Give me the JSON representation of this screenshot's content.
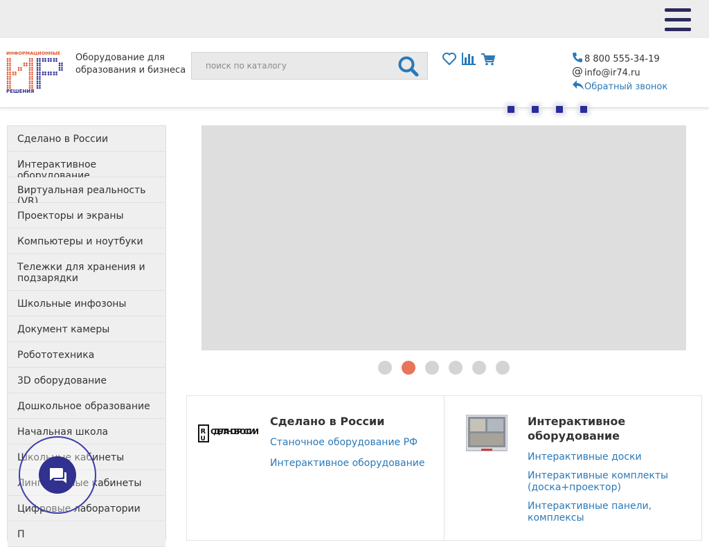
{
  "header": {
    "menu_icon": "hamburger-icon",
    "logo": {
      "top_text": "ИНФОРМАЦИОННЫЕ",
      "bottom_text": "РЕШЕНИЯ",
      "colors": [
        "#e0542d",
        "#2c2a8e"
      ]
    },
    "tagline": "Оборудование для образования и бизнеса",
    "search": {
      "placeholder": "поиск по каталогу",
      "icon": "search-icon"
    },
    "icons": [
      "heart-icon",
      "chart-icon",
      "cart-icon"
    ],
    "contacts": {
      "phone": "8 800 555-34-19",
      "email": "info@ir74.ru",
      "callback": "Обратный звонок"
    }
  },
  "sidebar": {
    "items": [
      "Сделано в России",
      "Интерактивное оборудование",
      "Виртуальная реальность (VR)",
      "Проекторы и экраны",
      "Компьютеры и ноутбуки",
      "Тележки для хранения и подзарядки",
      "Школьные инфозоны",
      "Документ камеры",
      "Робототехника",
      "3D оборудование",
      "Дошкольное образование",
      "Начальная школа",
      "Школьные кабинеты",
      "Лингафонные кабинеты",
      "Цифровые лаборатории",
      "П"
    ]
  },
  "slider": {
    "slide_count": 6,
    "active_index": 1
  },
  "cards": [
    {
      "title": "Сделано в России",
      "image_text": "СДЕЛАНО В РОССИИ",
      "links": [
        "Станочное оборудование РФ",
        "Интерактивное оборудование"
      ]
    },
    {
      "title": "Интерактивное оборудование",
      "image": "interactive-board-image",
      "links": [
        "Интерактивные доски",
        "Интерактивные комплекты (доска+проектор)",
        "Интерактивные панели, комплексы"
      ]
    }
  ],
  "chat": {
    "icon": "chat-icon"
  },
  "colors": {
    "accent": "#2a79b8",
    "brand_blue": "#2c2a8e",
    "brand_orange": "#e0542d",
    "active_dot": "#e8755a"
  }
}
